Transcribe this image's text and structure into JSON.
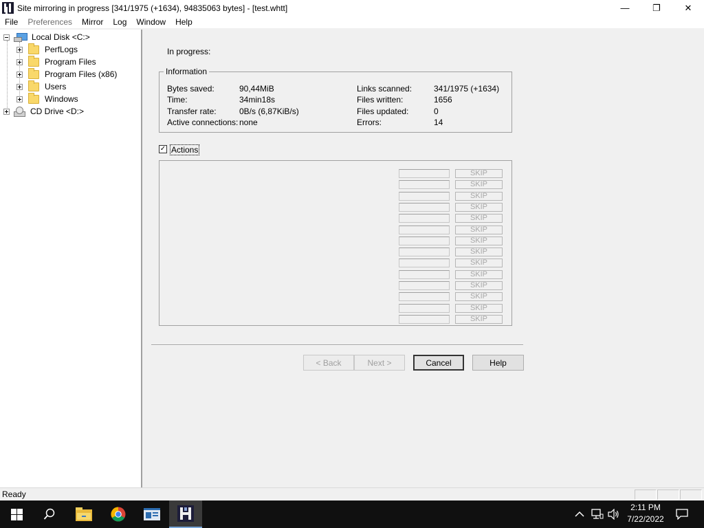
{
  "window": {
    "title": "Site mirroring in progress [341/1975 (+1634), 94835063 bytes] - [test.whtt]",
    "controls": {
      "minimize": "—",
      "maximize": "❐",
      "close": "✕"
    }
  },
  "menu": [
    {
      "label": "File",
      "disabled": false
    },
    {
      "label": "Preferences",
      "disabled": true
    },
    {
      "label": "Mirror",
      "disabled": false
    },
    {
      "label": "Log",
      "disabled": false
    },
    {
      "label": "Window",
      "disabled": false
    },
    {
      "label": "Help",
      "disabled": false
    }
  ],
  "tree": {
    "root": {
      "label": "Local Disk <C:>",
      "icon": "local-disk-icon",
      "expanded": true
    },
    "children": [
      {
        "label": "PerfLogs",
        "icon": "folder-icon"
      },
      {
        "label": "Program Files",
        "icon": "folder-icon"
      },
      {
        "label": "Program Files (x86)",
        "icon": "folder-icon"
      },
      {
        "label": "Users",
        "icon": "folder-icon"
      },
      {
        "label": "Windows",
        "icon": "folder-icon"
      }
    ],
    "cd": {
      "label": "CD Drive <D:>",
      "icon": "cd-drive-icon",
      "expanded": false
    }
  },
  "progress": {
    "status": "In progress:",
    "group_title": "Information",
    "left": [
      {
        "label": "Bytes saved:",
        "value": "90,44MiB"
      },
      {
        "label": "Time:",
        "value": "34min18s"
      },
      {
        "label": "Transfer rate:",
        "value": "0B/s (6,87KiB/s)"
      },
      {
        "label": "Active connections:",
        "value": "none"
      }
    ],
    "right": [
      {
        "label": "Links scanned:",
        "value": "341/1975 (+1634)"
      },
      {
        "label": "Files written:",
        "value": "1656"
      },
      {
        "label": "Files updated:",
        "value": "0"
      },
      {
        "label": "Errors:",
        "value": "14"
      }
    ]
  },
  "actions": {
    "label": "Actions",
    "checked": true,
    "check_mark": "✓",
    "skip_label": "SKIP",
    "slot_count": 14
  },
  "wizard": {
    "back": "< Back",
    "next": "Next >",
    "cancel": "Cancel",
    "help": "Help"
  },
  "statusbar": {
    "text": "Ready"
  },
  "taskbar": {
    "clock_time": "2:11 PM",
    "clock_date": "7/22/2022",
    "tray_icons": [
      "chevron-up-icon",
      "network-icon",
      "volume-icon"
    ]
  }
}
